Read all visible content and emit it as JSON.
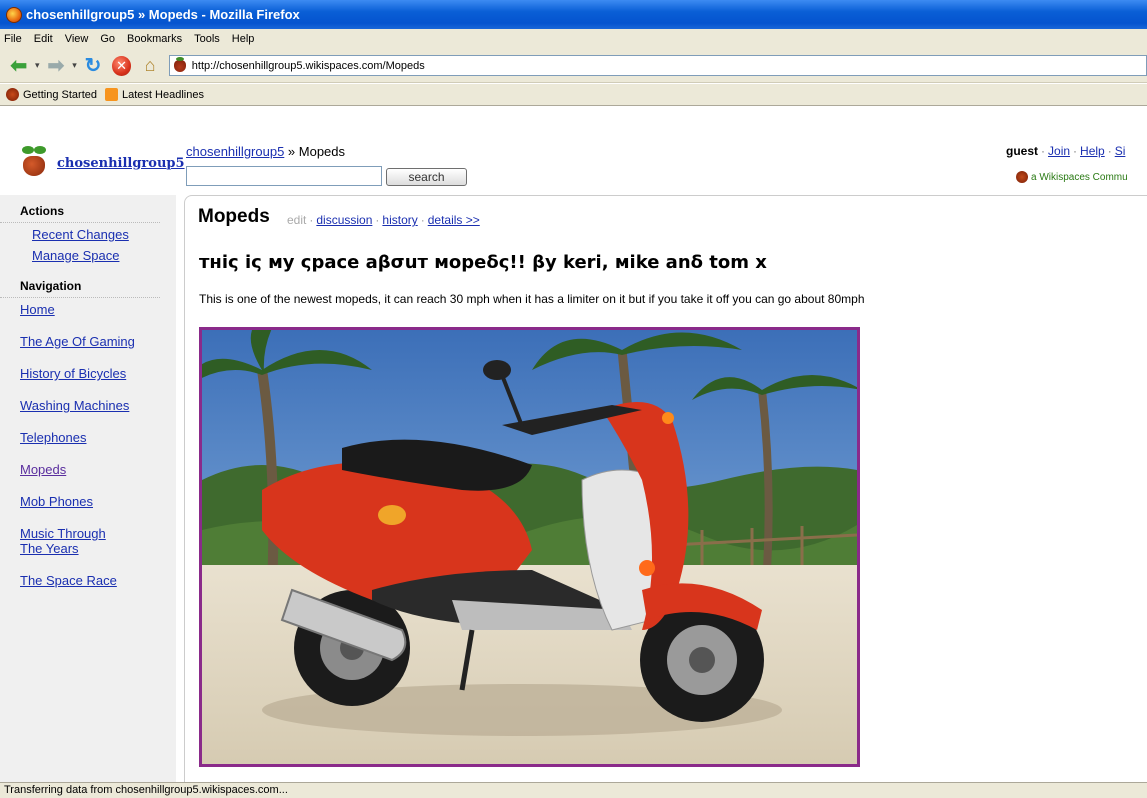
{
  "window": {
    "title": "chosenhillgroup5 » Mopeds - Mozilla Firefox"
  },
  "menu": [
    "File",
    "Edit",
    "View",
    "Go",
    "Bookmarks",
    "Tools",
    "Help"
  ],
  "address": {
    "url": "http://chosenhillgroup5.wikispaces.com/Mopeds"
  },
  "bookmarks": [
    "Getting Started",
    "Latest Headlines"
  ],
  "site": {
    "name": "chosenhillgroup5",
    "breadcrumb_link": "chosenhillgroup5",
    "breadcrumb_sep": " » ",
    "breadcrumb_current": "Mopeds",
    "search_value": "",
    "search_button": "search",
    "user": "guest",
    "join": "Join",
    "help": "Help",
    "signin": "Si",
    "community": "a Wikispaces Commu"
  },
  "sidebar": {
    "actions_heading": "Actions",
    "actions": [
      "Recent Changes",
      "Manage Space"
    ],
    "nav_heading": "Navigation",
    "nav": [
      "Home",
      "The Age Of Gaming",
      "History of Bicycles",
      "Washing Machines",
      "Telephones",
      "Mopeds",
      "Mob Phones",
      "Music Through The Years",
      "The Space Race"
    ]
  },
  "page": {
    "title": "Mopeds",
    "edit": "edit",
    "discussion": "discussion",
    "history": "history",
    "details": "details >>",
    "heading": "тнiς iς мy ςpace aβσuт мopeδς!! βy keri, мike anδ tom x",
    "text": "This is one of the newest mopeds, it can reach 30 mph when it has a limiter on it but if you take it off you can go about 80mph"
  },
  "status": {
    "text": "Transferring data from chosenhillgroup5.wikispaces.com..."
  },
  "colors": {
    "link": "#1a2fb0",
    "titlebar": "#0554cf",
    "moped_red": "#d8351c"
  }
}
